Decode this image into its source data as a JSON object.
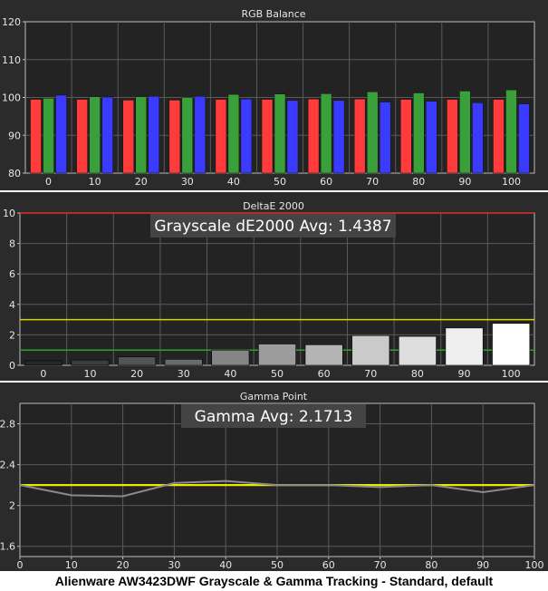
{
  "caption": "Alienware AW3423DWF Grayscale & Gamma Tracking - Standard, default",
  "colors": {
    "panel_bg": "#2b2b2b",
    "plot_bg": "#232323",
    "grid": "#5a5a5a",
    "text": "#e6e6e6",
    "red": "#ff3b3b",
    "green": "#3aa03a",
    "blue": "#3b3bff",
    "limit_red": "#e03030",
    "limit_yellow": "#d6d600",
    "limit_green": "#2ea02e",
    "gamma_target": "#e8e800",
    "gamma_line": "#8a8a8a"
  },
  "chart_data": [
    {
      "type": "bar",
      "title": "RGB Balance",
      "categories": [
        "0",
        "10",
        "20",
        "30",
        "40",
        "50",
        "60",
        "70",
        "80",
        "90",
        "100"
      ],
      "series": [
        {
          "color": "#ff3b3b",
          "values": [
            99.5,
            99.5,
            99.3,
            99.3,
            99.5,
            99.5,
            99.6,
            99.6,
            99.5,
            99.5,
            99.5
          ]
        },
        {
          "color": "#3aa03a",
          "values": [
            99.8,
            100.2,
            100.2,
            100.0,
            100.8,
            100.9,
            101.0,
            101.5,
            101.2,
            101.7,
            102.0
          ]
        },
        {
          "color": "#3b3bff",
          "values": [
            100.6,
            100.1,
            100.3,
            100.3,
            99.6,
            99.2,
            99.2,
            98.8,
            99.0,
            98.6,
            98.3
          ]
        }
      ],
      "ylim": [
        80,
        120
      ],
      "yticks": [
        "80",
        "90",
        "100",
        "110",
        "120"
      ],
      "grid": true
    },
    {
      "type": "bar",
      "title": "DeltaE 2000",
      "annotation": "Grayscale dE2000 Avg: 1.4387",
      "categories": [
        "0",
        "10",
        "20",
        "30",
        "40",
        "50",
        "60",
        "70",
        "80",
        "90",
        "100"
      ],
      "values": [
        0.3,
        0.35,
        0.55,
        0.4,
        1.0,
        1.4,
        1.35,
        1.95,
        1.9,
        2.45,
        2.75
      ],
      "bar_colors": [
        "#262626",
        "#3c3c3c",
        "#545454",
        "#6b6b6b",
        "#858585",
        "#9c9c9c",
        "#b4b4b4",
        "#cacaca",
        "#dedede",
        "#eeeeee",
        "#ffffff"
      ],
      "reference_lines": [
        {
          "value": 10,
          "color": "#e03030"
        },
        {
          "value": 3,
          "color": "#d6d600"
        },
        {
          "value": 1,
          "color": "#2ea02e"
        }
      ],
      "ylim": [
        0,
        10
      ],
      "yticks": [
        "0",
        "2",
        "4",
        "6",
        "8",
        "10"
      ],
      "grid": true
    },
    {
      "type": "line",
      "title": "Gamma Point",
      "annotation": "Gamma Avg: 2.1713",
      "x": [
        0,
        10,
        20,
        30,
        40,
        50,
        60,
        70,
        80,
        90,
        100
      ],
      "target": 2.2,
      "values": [
        2.2,
        2.1,
        2.09,
        2.22,
        2.24,
        2.2,
        2.2,
        2.18,
        2.2,
        2.13,
        2.2
      ],
      "ylim": [
        1.5,
        3.0
      ],
      "yticks": [
        "1.6",
        "2",
        "2.4",
        "2.8"
      ],
      "xticks": [
        "0",
        "10",
        "20",
        "30",
        "40",
        "50",
        "60",
        "70",
        "80",
        "90",
        "100"
      ],
      "grid": true
    }
  ]
}
